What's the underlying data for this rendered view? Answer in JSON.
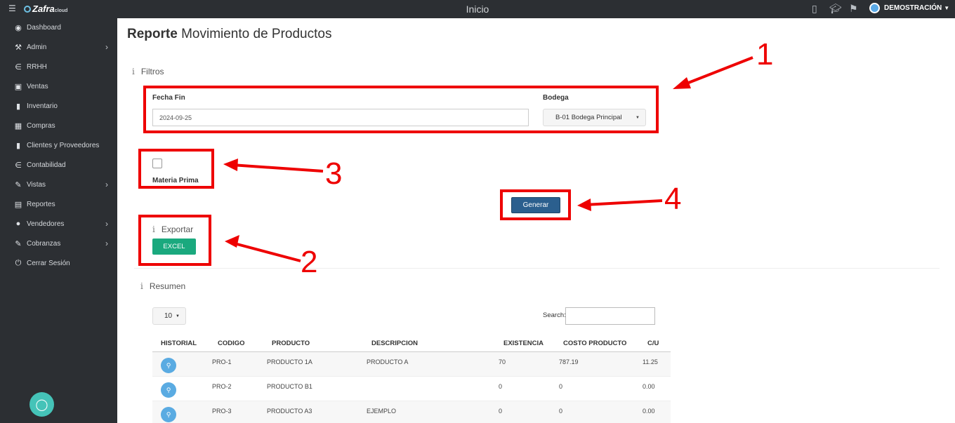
{
  "topbar": {
    "brand": "Zafra",
    "brand_suffix": "cloud",
    "title": "Inicio",
    "user": "DEMOSTRACIÓN"
  },
  "sidebar": {
    "items": [
      {
        "label": "Dashboard",
        "icon": "dashboard-icon",
        "has_submenu": false
      },
      {
        "label": "Admin",
        "icon": "wrench-icon",
        "has_submenu": true
      },
      {
        "label": "RRHH",
        "icon": "paperclip-icon",
        "has_submenu": false
      },
      {
        "label": "Ventas",
        "icon": "money-icon",
        "has_submenu": false
      },
      {
        "label": "Inventario",
        "icon": "book-icon",
        "has_submenu": false
      },
      {
        "label": "Compras",
        "icon": "cart-icon",
        "has_submenu": false
      },
      {
        "label": "Clientes y Proveedores",
        "icon": "book-icon",
        "has_submenu": false
      },
      {
        "label": "Contabilidad",
        "icon": "paperclip-icon",
        "has_submenu": false
      },
      {
        "label": "Vistas",
        "icon": "edit-icon",
        "has_submenu": true
      },
      {
        "label": "Reportes",
        "icon": "list-icon",
        "has_submenu": false
      },
      {
        "label": "Vendedores",
        "icon": "user-icon",
        "has_submenu": true
      },
      {
        "label": "Cobranzas",
        "icon": "edit-icon",
        "has_submenu": true
      },
      {
        "label": "Cerrar Sesión",
        "icon": "power-icon",
        "has_submenu": false
      }
    ]
  },
  "page": {
    "title_bold": "Reporte",
    "title_rest": "Movimiento de Productos"
  },
  "filters": {
    "section_label": "Filtros",
    "fecha_fin_label": "Fecha Fin",
    "fecha_fin_value": "2024-09-25",
    "bodega_label": "Bodega",
    "bodega_value": "B-01 Bodega Principal",
    "materia_prima_label": "Materia Prima",
    "materia_prima_checked": false,
    "generar_label": "Generar"
  },
  "export": {
    "section_label": "Exportar",
    "excel_label": "EXCEL"
  },
  "summary": {
    "section_label": "Resumen",
    "page_length": "10",
    "search_label": "Search:",
    "columns": [
      "HISTORIAL",
      "CODIGO",
      "PRODUCTO",
      "DESCRIPCION",
      "EXISTENCIA",
      "COSTO PRODUCTO",
      "C/U"
    ],
    "rows": [
      {
        "codigo": "PRO-1",
        "producto": "PRODUCTO 1A",
        "descripcion": "PRODUCTO A",
        "existencia": "70",
        "costo": "787.19",
        "cu": "11.25"
      },
      {
        "codigo": "PRO-2",
        "producto": "PRODUCTO B1",
        "descripcion": "",
        "existencia": "0",
        "costo": "0",
        "cu": "0.00"
      },
      {
        "codigo": "PRO-3",
        "producto": "PRODUCTO A3",
        "descripcion": "EJEMPLO",
        "existencia": "0",
        "costo": "0",
        "cu": "0.00"
      }
    ]
  },
  "annotations": {
    "color": "#ee0000",
    "numbers": [
      "1",
      "2",
      "3",
      "4"
    ]
  }
}
